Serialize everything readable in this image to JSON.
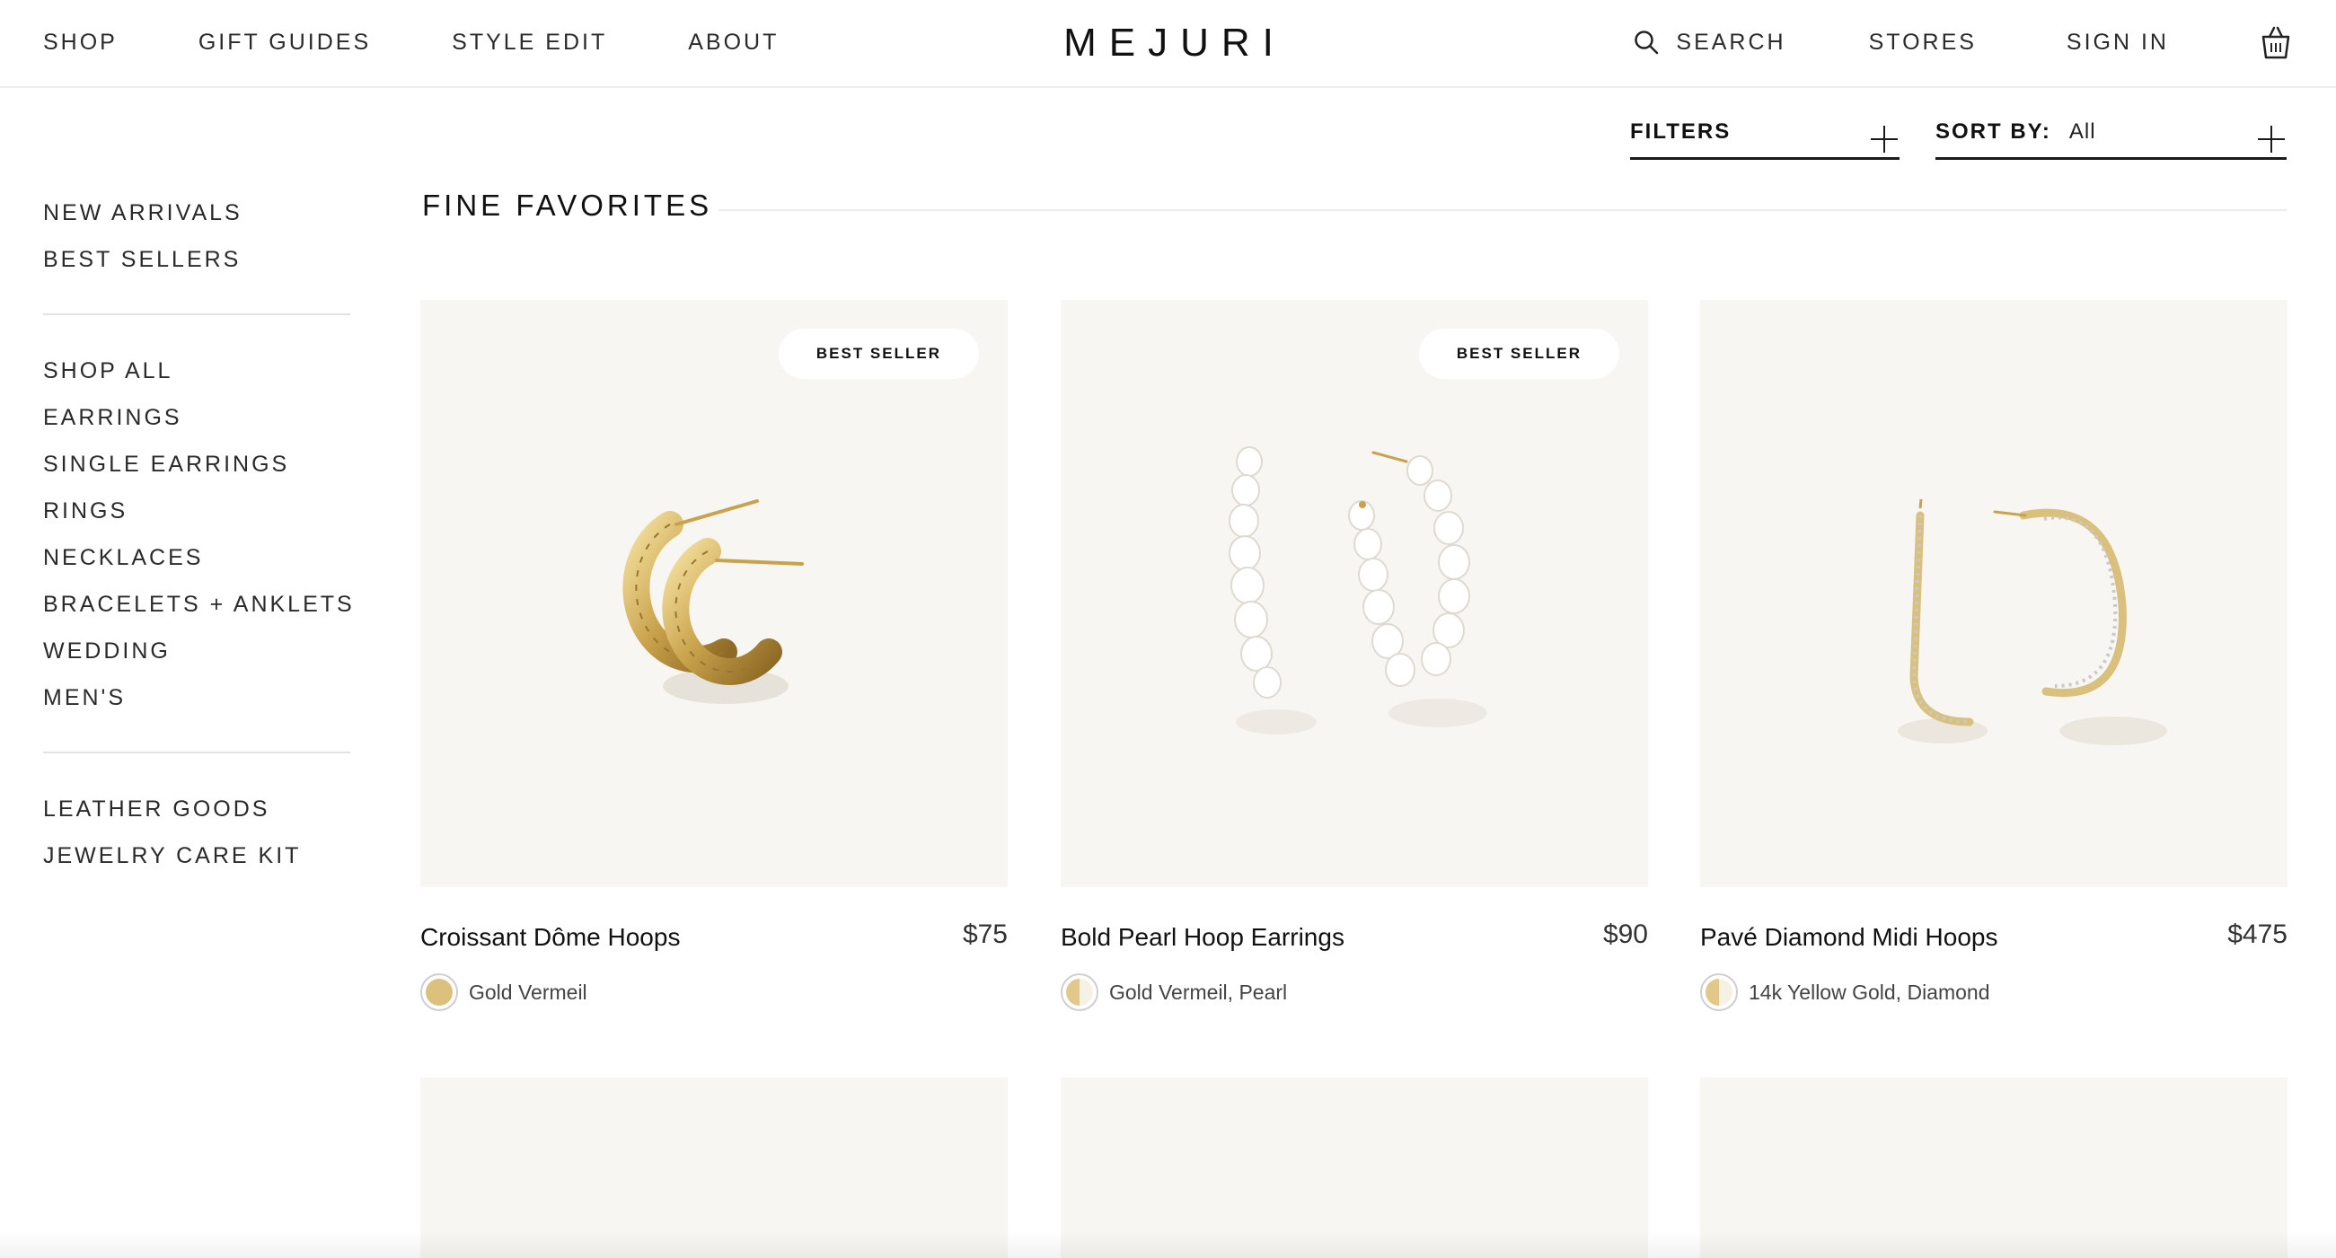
{
  "header": {
    "nav_left": [
      "SHOP",
      "GIFT GUIDES",
      "STYLE EDIT",
      "ABOUT"
    ],
    "logo": "MEJURI",
    "search_label": "SEARCH",
    "stores_label": "STORES",
    "signin_label": "SIGN IN"
  },
  "filters": {
    "filters_label": "FILTERS",
    "sort_label": "SORT BY:",
    "sort_value": "All"
  },
  "sidebar": {
    "group1": [
      "NEW ARRIVALS",
      "BEST SELLERS"
    ],
    "group2": [
      "SHOP ALL",
      "EARRINGS",
      "SINGLE EARRINGS",
      "RINGS",
      "NECKLACES",
      "BRACELETS + ANKLETS",
      "WEDDING",
      "MEN'S"
    ],
    "group3": [
      "LEATHER GOODS",
      "JEWELRY CARE KIT"
    ]
  },
  "section": {
    "title": "FINE FAVORITES"
  },
  "products": [
    {
      "name": "Croissant Dôme Hoops",
      "price": "$75",
      "material": "Gold Vermeil",
      "badge": "BEST SELLER"
    },
    {
      "name": "Bold Pearl Hoop Earrings",
      "price": "$90",
      "material": "Gold Vermeil, Pearl",
      "badge": "BEST SELLER"
    },
    {
      "name": "Pavé Diamond Midi Hoops",
      "price": "$475",
      "material": "14k Yellow Gold, Diamond",
      "badge": ""
    }
  ],
  "icons": {
    "search": "search-icon",
    "cart": "shopping-bag-icon",
    "plus": "plus-icon"
  },
  "colors": {
    "card_background": "#f8f6f2",
    "gold": "#dcc07e",
    "text": "#111111"
  }
}
